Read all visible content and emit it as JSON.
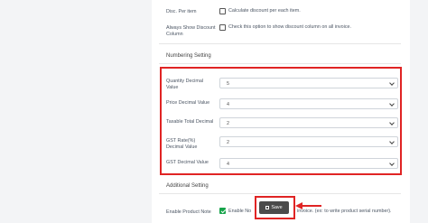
{
  "discount_rows": [
    {
      "label": "Disc. Per item",
      "checkbox_text": "Calculate discount per each item."
    },
    {
      "label": "Always Show Discount Column",
      "checkbox_text": "Check this option to show discount column on all invoice."
    }
  ],
  "numbering_setting": {
    "title": "Numbering Setting",
    "fields": [
      {
        "label": "Quantity Decimal Value",
        "value": "5"
      },
      {
        "label": "Price Decimal Value",
        "value": "4"
      },
      {
        "label": "Taxable Total Decimal",
        "value": "2"
      },
      {
        "label": "GST Rate(%) Decimal Value",
        "value": "2"
      },
      {
        "label": "GST Decimal Value",
        "value": "4"
      }
    ]
  },
  "additional_setting": {
    "title": "Additional Setting",
    "enable_product_note": {
      "label": "Enable Product Note",
      "checked": true,
      "text_start": "Enable No",
      "text_end": "invoice. (ex: to write product serial number)."
    }
  },
  "save_button": {
    "label": "Save",
    "icon": "floppy-disk-icon"
  },
  "colors": {
    "highlight": "#e02424",
    "checkbox_on": "#16a34a",
    "save_bg": "#4b4b4b"
  }
}
